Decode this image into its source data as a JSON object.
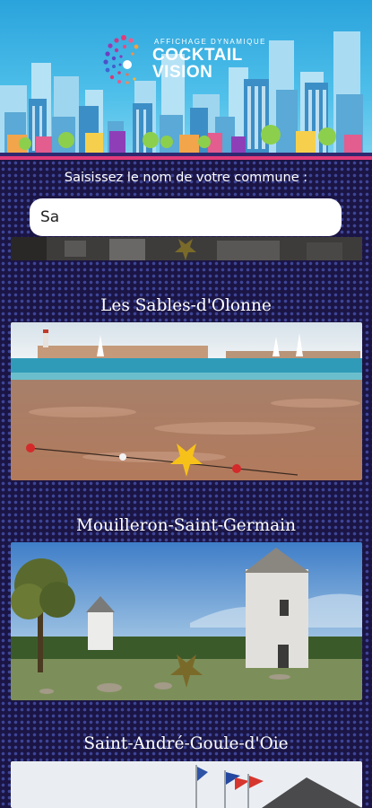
{
  "brand": {
    "tagline": "AFFICHAGE DYNAMIQUE",
    "name_line1": "COCKTAIL",
    "name_line2": "VISION"
  },
  "search": {
    "prompt": "Saisissez le nom de votre commune :",
    "value": "Sa"
  },
  "cities": [
    {
      "name": "Les Sables-d'Olonne",
      "favorite": true
    },
    {
      "name": "Mouilleron-Saint-Germain",
      "favorite": false
    },
    {
      "name": "Saint-André-Goule-d'Oie",
      "favorite": false
    }
  ],
  "colors": {
    "star_active": "#f6c21a",
    "star_inactive": "#7a6a2a",
    "accent": "#e23b7a",
    "sky": "#2aa3dc"
  }
}
